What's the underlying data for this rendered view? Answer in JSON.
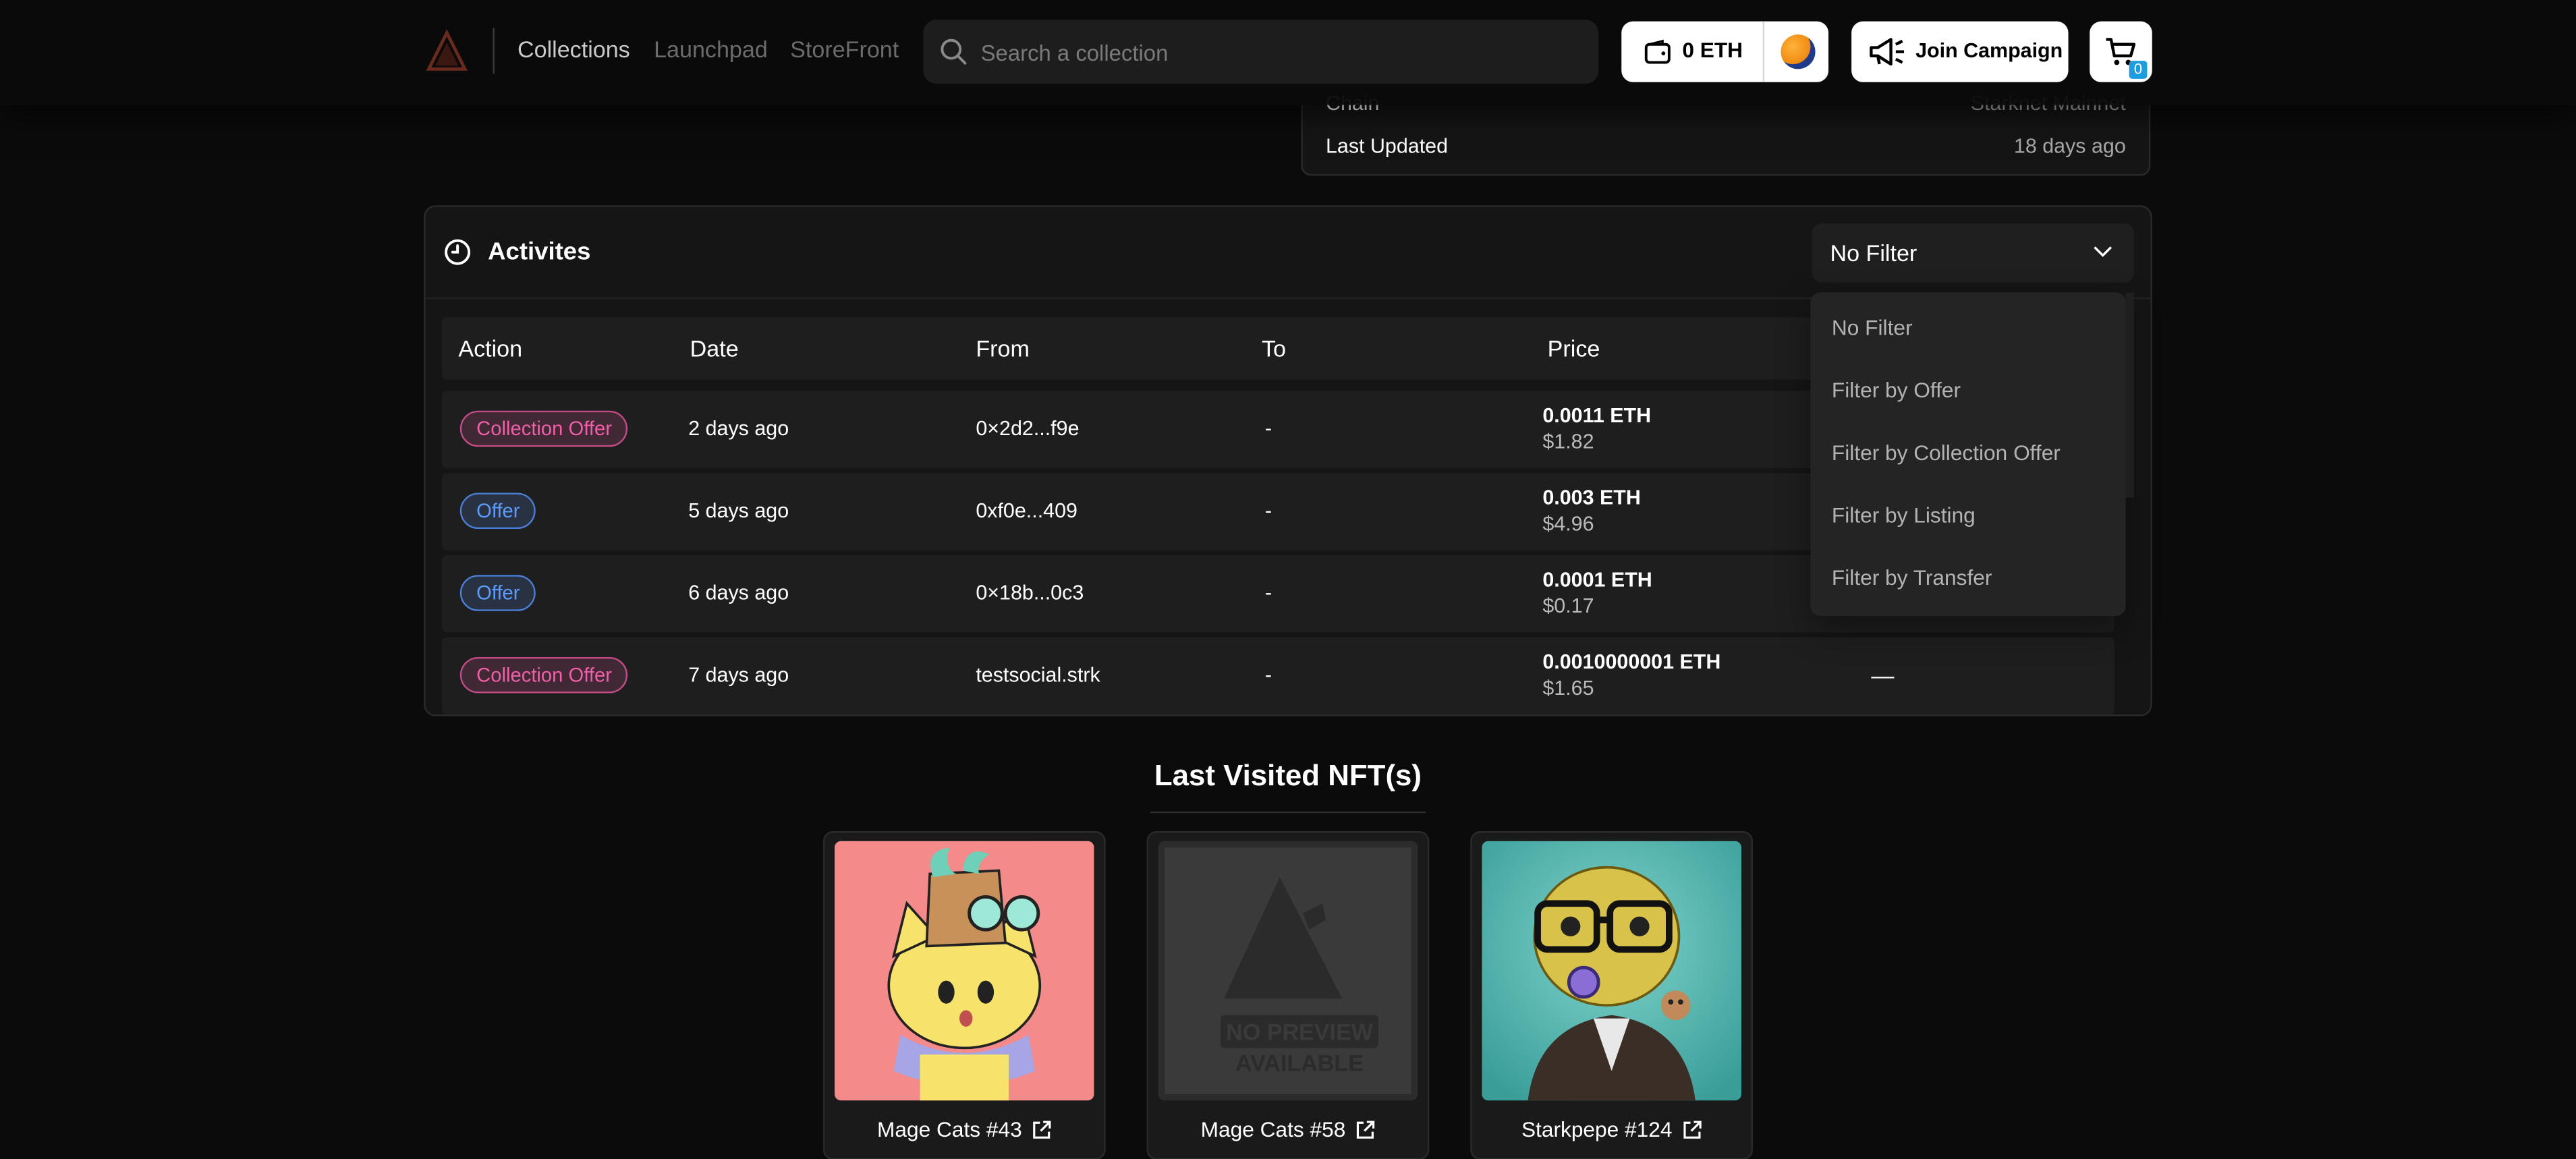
{
  "nav": {
    "links": [
      "Collections",
      "Launchpad",
      "StoreFront"
    ],
    "search_placeholder": "Search a collection",
    "wallet_balance": "0 ETH",
    "campaign_label": "Join Campaign",
    "cart_count": "0"
  },
  "details": {
    "rows": [
      {
        "key": "Chain",
        "value": "Starknet Mainnet"
      },
      {
        "key": "Last Updated",
        "value": "18 days ago"
      }
    ]
  },
  "activities": {
    "title": "Activites",
    "filter_selected": "No Filter",
    "headers": [
      "Action",
      "Date",
      "From",
      "To",
      "Price"
    ],
    "rows": [
      {
        "action": "Collection Offer",
        "action_type": "collection",
        "date": "2 days ago",
        "from": "0×2d2...f9e",
        "to": "-",
        "price_eth": "0.0011 ETH",
        "price_usd": "$1.82",
        "extra": ""
      },
      {
        "action": "Offer",
        "action_type": "offer",
        "date": "5 days ago",
        "from": "0xf0e...409",
        "to": "-",
        "price_eth": "0.003 ETH",
        "price_usd": "$4.96",
        "extra": ""
      },
      {
        "action": "Offer",
        "action_type": "offer",
        "date": "6 days ago",
        "from": "0×18b...0c3",
        "to": "-",
        "price_eth": "0.0001 ETH",
        "price_usd": "$0.17",
        "extra": ""
      },
      {
        "action": "Collection Offer",
        "action_type": "collection",
        "date": "7 days ago",
        "from": "testsocial.strk",
        "to": "-",
        "price_eth": "0.0010000001 ETH",
        "price_usd": "$1.65",
        "extra": "—"
      }
    ],
    "filter_options": [
      "No Filter",
      "Filter by Offer",
      "Filter by Collection Offer",
      "Filter by Listing",
      "Filter by Transfer"
    ]
  },
  "last_visited": {
    "title": "Last Visited NFT(s)",
    "items": [
      {
        "name": "Mage Cats #43",
        "image": "mage-cat-illustration"
      },
      {
        "name": "Mage Cats #58",
        "image": "no-preview-placeholder",
        "placeholder_text": [
          "NO PREVIEW",
          "AVAILABLE"
        ]
      },
      {
        "name": "Starkpepe #124",
        "image": "pepe-portrait"
      }
    ]
  },
  "colors": {
    "background": "#0b0b0b",
    "card": "#151515",
    "row": "#1e1e1e",
    "collection_offer_pink": "#f25ea8",
    "offer_blue": "#5b9cff",
    "cart_badge": "#1f9be0"
  }
}
